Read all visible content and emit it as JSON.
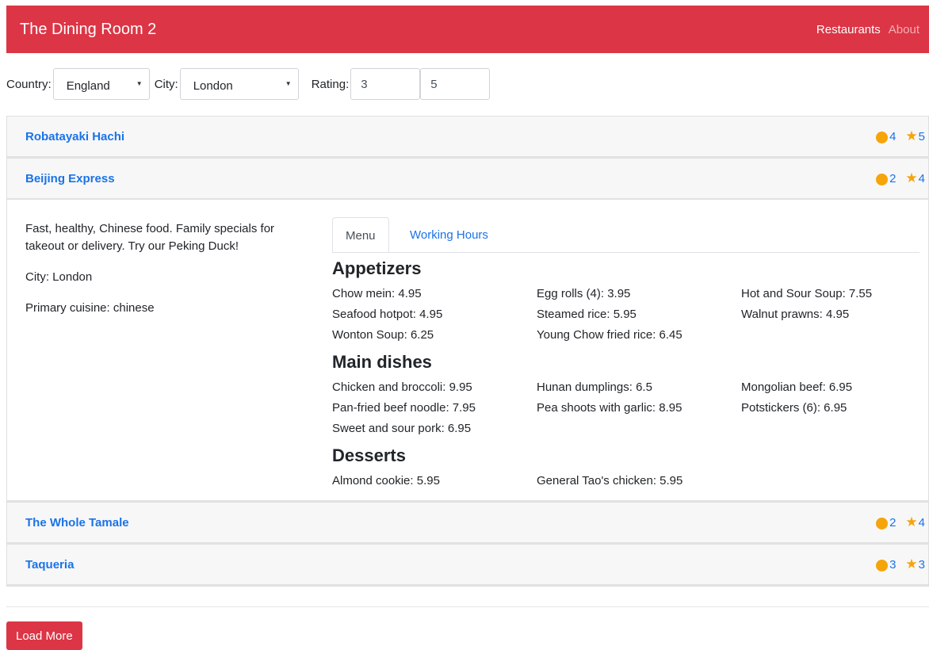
{
  "app": {
    "title": "The Dining Room 2",
    "nav": [
      "Restaurants",
      "About"
    ]
  },
  "filters": {
    "country_label": "Country:",
    "country_value": "England",
    "city_label": "City:",
    "city_value": "London",
    "rating_label": "Rating:",
    "rating_min": "3",
    "rating_max": "5"
  },
  "restaurants": [
    {
      "name": "Robatayaki Hachi",
      "price": "4",
      "rating": "5"
    },
    {
      "name": "Beijing Express",
      "price": "2",
      "rating": "4",
      "description": "Fast, healthy, Chinese food. Family specials for takeout or delivery. Try our Peking Duck!",
      "city": "City: London",
      "cuisine": "Primary cuisine: chinese",
      "tabs": [
        "Menu",
        "Working Hours"
      ],
      "menu": [
        {
          "title": "Appetizers",
          "items": [
            "Chow mein: 4.95",
            "Egg rolls (4): 3.95",
            "Hot and Sour Soup: 7.55",
            "Seafood hotpot: 4.95",
            "Steamed rice: 5.95",
            "Walnut prawns: 4.95",
            "Wonton Soup: 6.25",
            "Young Chow fried rice: 6.45"
          ]
        },
        {
          "title": "Main dishes",
          "items": [
            "Chicken and broccoli: 9.95",
            "Hunan dumplings: 6.5",
            "Mongolian beef: 6.95",
            "Pan-fried beef noodle: 7.95",
            "Pea shoots with garlic: 8.95",
            "Potstickers (6): 6.95",
            "Sweet and sour pork: 6.95"
          ]
        },
        {
          "title": "Desserts",
          "items": [
            "Almond cookie: 5.95",
            "General Tao's chicken: 5.95"
          ]
        }
      ]
    },
    {
      "name": "The Whole Tamale",
      "price": "2",
      "rating": "4"
    },
    {
      "name": "Taqueria",
      "price": "3",
      "rating": "3"
    }
  ],
  "load_more": "Load More",
  "colors": {
    "brand": "#dc3545",
    "link": "#1a73e8",
    "badge": "#f5a40a"
  },
  "icons": {
    "price": "coin-icon",
    "rating": "star-icon",
    "dropdown": "caret-down-icon"
  }
}
